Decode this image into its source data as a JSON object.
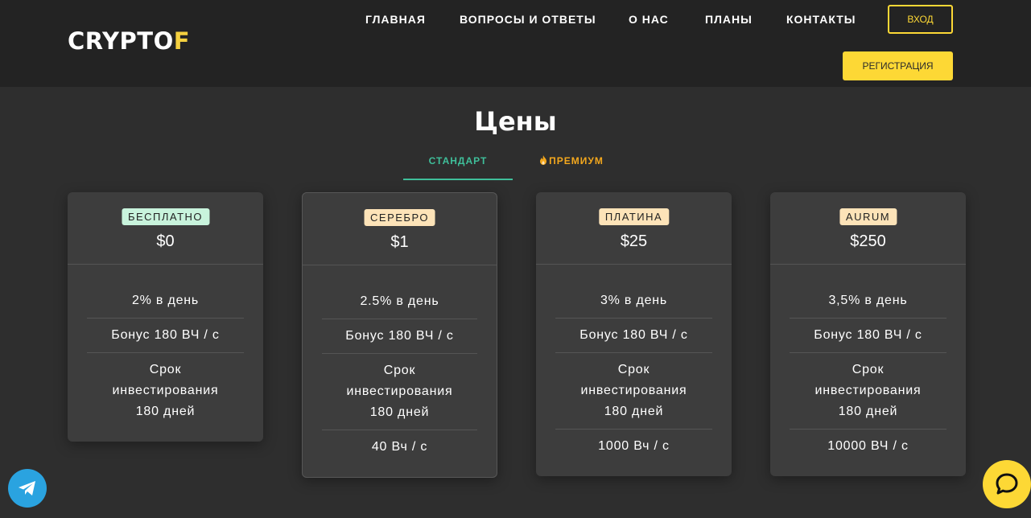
{
  "header": {
    "logo_part1": "CRYPTO",
    "logo_part2": "F",
    "nav": [
      "ГЛАВНАЯ",
      "ВОПРОСЫ И ОТВЕТЫ",
      "О НАС",
      "ПЛАНЫ",
      "КОНТАКТЫ"
    ],
    "login_label": "ВХОД",
    "register_label": "РЕГИСТРАЦИЯ"
  },
  "pricing": {
    "title": "Цены",
    "tabs": [
      {
        "label": "СТАНДАРТ",
        "active": true
      },
      {
        "label": "ПРЕМИУМ",
        "active": false,
        "icon": "flame-icon"
      }
    ],
    "plans": [
      {
        "badge": "БЕСПЛАТНО",
        "badge_color": "#c8f3dc",
        "price": "$0",
        "features": [
          "2% в день",
          "Бонус 180 ВЧ / с",
          "Срок инвестирования 180 дней"
        ]
      },
      {
        "badge": "СЕРЕБРО",
        "badge_color": "#fde3b8",
        "price": "$1",
        "features": [
          "2.5% в день",
          "Бонус 180 ВЧ / с",
          "Срок инвестирования 180 дней",
          "40 Вч / с"
        ]
      },
      {
        "badge": "ПЛАТИНА",
        "badge_color": "#fde3b8",
        "price": "$25",
        "features": [
          "3% в день",
          "Бонус 180 ВЧ / с",
          "Срок инвестирования 180 дней",
          "1000 Вч / с"
        ]
      },
      {
        "badge": "AURUM",
        "badge_color": "#fde3b8",
        "price": "$250",
        "features": [
          "3,5% в день",
          "Бонус 180 ВЧ / с",
          "Срок инвестирования 180 дней",
          "10000 ВЧ / с"
        ]
      }
    ]
  },
  "colors": {
    "accent_yellow": "#fdd835",
    "accent_green": "#3fbf9a",
    "premium_orange": "#f4a81d"
  },
  "floating": {
    "telegram_icon": "telegram-icon",
    "chat_icon": "chat-icon"
  }
}
